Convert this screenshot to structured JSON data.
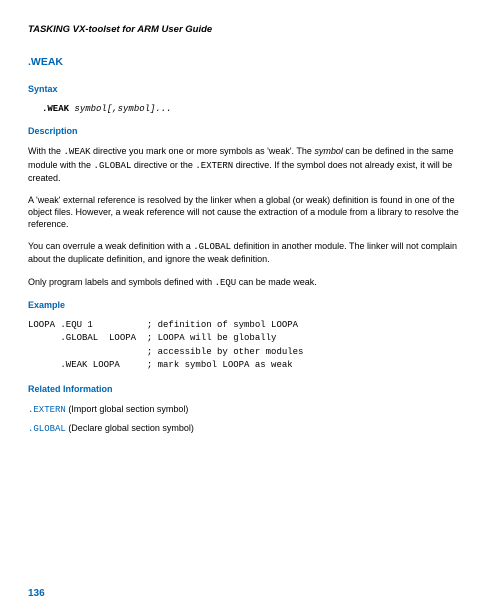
{
  "header": "TASKING VX-toolset for ARM User Guide",
  "title": ".WEAK",
  "syntax": {
    "heading": "Syntax",
    "keyword": ".WEAK",
    "args": "symbol[,symbol]..."
  },
  "description": {
    "heading": "Description",
    "p1_a": "With the ",
    "p1_b": ".WEAK",
    "p1_c": " directive you mark one or more symbols as 'weak'. The ",
    "p1_d": "symbol",
    "p1_e": " can be defined in the same module with the ",
    "p1_f": ".GLOBAL",
    "p1_g": " directive or the ",
    "p1_h": ".EXTERN",
    "p1_i": " directive. If the symbol does not already exist, it will be created.",
    "p2": "A 'weak' external reference is resolved by the linker when a global (or weak) definition is found in one of the object files. However, a weak reference will not cause the extraction of a module from a library to resolve the reference.",
    "p3_a": "You can overrule a weak definition with a ",
    "p3_b": ".GLOBAL",
    "p3_c": " definition in another module. The linker will not complain about the duplicate definition, and ignore the weak definition.",
    "p4_a": "Only program labels and symbols defined with ",
    "p4_b": ".EQU",
    "p4_c": " can be made weak."
  },
  "example": {
    "heading": "Example",
    "code": "LOOPA .EQU 1          ; definition of symbol LOOPA\n      .GLOBAL  LOOPA  ; LOOPA will be globally\n                      ; accessible by other modules\n      .WEAK LOOPA     ; mark symbol LOOPA as weak"
  },
  "related": {
    "heading": "Related Information",
    "r1_kw": ".EXTERN",
    "r1_txt": " (Import global section symbol)",
    "r2_kw": ".GLOBAL",
    "r2_txt": " (Declare global section symbol)"
  },
  "pageNumber": "136"
}
